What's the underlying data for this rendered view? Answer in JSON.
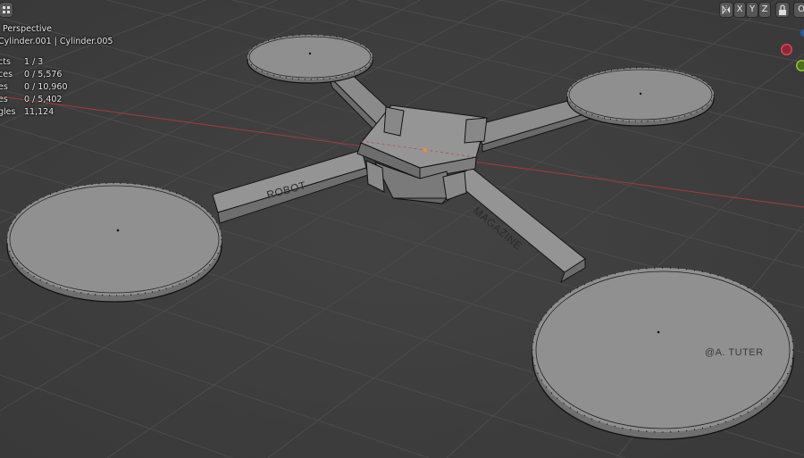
{
  "header": {
    "menu_icon": "menu-icon",
    "mirror_icon": "mirror-icon",
    "axis_x": "X",
    "axis_y": "Y",
    "axis_z": "Z",
    "lock_icon": "lock-icon",
    "overlay_label": "O"
  },
  "viewport": {
    "view_name": "Perspective",
    "selected_objects": "Cylinder.001 | Cylinder.005"
  },
  "stats": {
    "objects_label": "cts",
    "objects_value": "1 / 3",
    "vertices_label": "ces",
    "vertices_value": "0 / 5,576",
    "edges_label": "es",
    "edges_value": "0 / 10,960",
    "faces_label": "es",
    "faces_value": "0 / 5,402",
    "triangles_label": "gles",
    "triangles_value": "11,124"
  },
  "model_labels": {
    "arm_left": "ROBOT",
    "arm_right": "MAGAZINE",
    "watermark": "@A. TUTER"
  },
  "colors": {
    "background": "#3d3d3d",
    "grid_line": "#4a4a4a",
    "x_axis": "#a83a3a",
    "mesh_fill": "#8a8a8a",
    "mesh_edge": "#111111"
  }
}
